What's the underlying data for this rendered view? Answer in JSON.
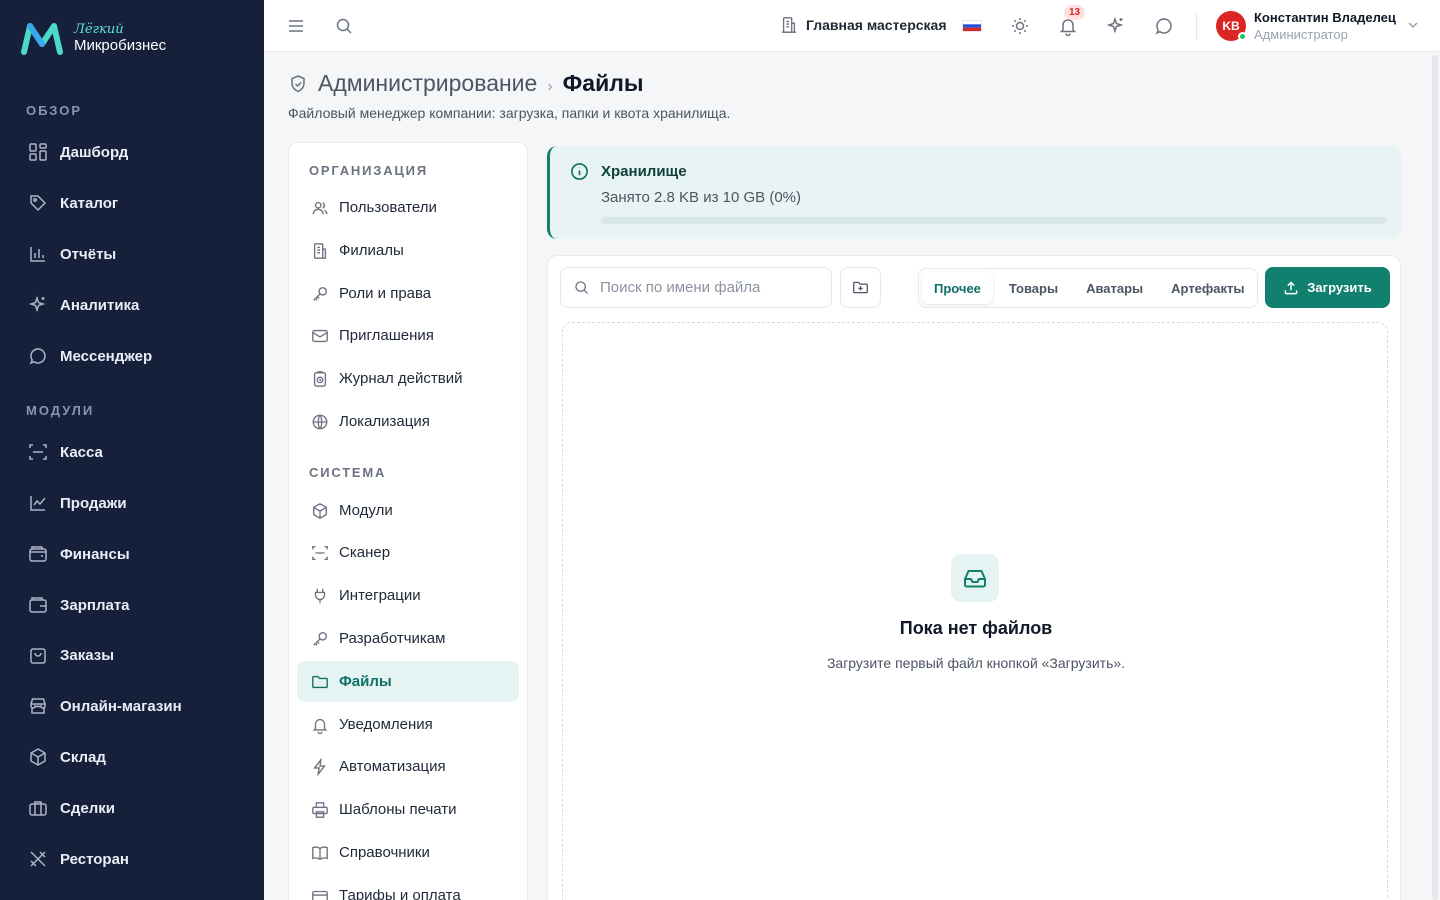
{
  "brand": {
    "top": "Лёгкий",
    "bottom": "Микробизнес",
    "accent": "#5ee6d8"
  },
  "sidebar": {
    "sections": [
      {
        "title": "ОБЗОР",
        "items": [
          {
            "label": "Дашборд",
            "icon": "grid-icon"
          },
          {
            "label": "Каталог",
            "icon": "tag-icon"
          },
          {
            "label": "Отчёты",
            "icon": "bar-chart-icon"
          },
          {
            "label": "Аналитика",
            "icon": "sparkles-icon"
          },
          {
            "label": "Мессенджер",
            "icon": "chat-icon"
          }
        ]
      },
      {
        "title": "МОДУЛИ",
        "items": [
          {
            "label": "Касса",
            "icon": "scan-icon"
          },
          {
            "label": "Продажи",
            "icon": "line-chart-icon"
          },
          {
            "label": "Финансы",
            "icon": "wallet-icon"
          },
          {
            "label": "Зарплата",
            "icon": "wallet-icon"
          },
          {
            "label": "Заказы",
            "icon": "bag-icon"
          },
          {
            "label": "Онлайн-магазин",
            "icon": "store-icon"
          },
          {
            "label": "Склад",
            "icon": "box-icon"
          },
          {
            "label": "Сделки",
            "icon": "briefcase-icon"
          },
          {
            "label": "Ресторан",
            "icon": "utensils-icon"
          }
        ]
      }
    ]
  },
  "topbar": {
    "workshop": "Главная мастерская",
    "notifications_count": "13",
    "user": {
      "initials": "KB",
      "name": "Константин Владелец",
      "role": "Администратор"
    }
  },
  "header": {
    "root": "Администрирование",
    "separator": "›",
    "current": "Файлы",
    "subtitle": "Файловый менеджер компании: загрузка, папки и квота хранилища."
  },
  "admin_nav": {
    "sections": [
      {
        "title": "ОРГАНИЗАЦИЯ",
        "items": [
          {
            "label": "Пользователи",
            "icon": "users-icon"
          },
          {
            "label": "Филиалы",
            "icon": "building-icon"
          },
          {
            "label": "Роли и права",
            "icon": "key-icon"
          },
          {
            "label": "Приглашения",
            "icon": "mail-icon"
          },
          {
            "label": "Журнал действий",
            "icon": "history-icon"
          },
          {
            "label": "Локализация",
            "icon": "globe-icon"
          }
        ]
      },
      {
        "title": "СИСТЕМА",
        "items": [
          {
            "label": "Модули",
            "icon": "box-icon"
          },
          {
            "label": "Сканер",
            "icon": "scan-icon"
          },
          {
            "label": "Интеграции",
            "icon": "plug-icon"
          },
          {
            "label": "Разработчикам",
            "icon": "key-icon"
          },
          {
            "label": "Файлы",
            "icon": "folder-icon",
            "active": true
          },
          {
            "label": "Уведомления",
            "icon": "bell-icon"
          },
          {
            "label": "Автоматизация",
            "icon": "zap-icon"
          },
          {
            "label": "Шаблоны печати",
            "icon": "printer-icon"
          },
          {
            "label": "Справочники",
            "icon": "book-icon"
          },
          {
            "label": "Тарифы и оплата",
            "icon": "wallet-icon"
          }
        ]
      }
    ]
  },
  "storage": {
    "title": "Хранилище",
    "used_text": "Занято 2.8 KB из 10 GB (0%)",
    "percent": 0
  },
  "files": {
    "search_placeholder": "Поиск по имени файла",
    "tabs": [
      {
        "label": "Прочее",
        "active": true
      },
      {
        "label": "Товары"
      },
      {
        "label": "Аватары"
      },
      {
        "label": "Артефакты"
      }
    ],
    "upload_label": "Загрузить",
    "empty_title": "Пока нет файлов",
    "empty_desc": "Загрузите первый файл кнопкой «Загрузить»."
  },
  "colors": {
    "primary": "#12806f",
    "sidebar_bg": "#17203a",
    "danger": "#dc2626"
  }
}
